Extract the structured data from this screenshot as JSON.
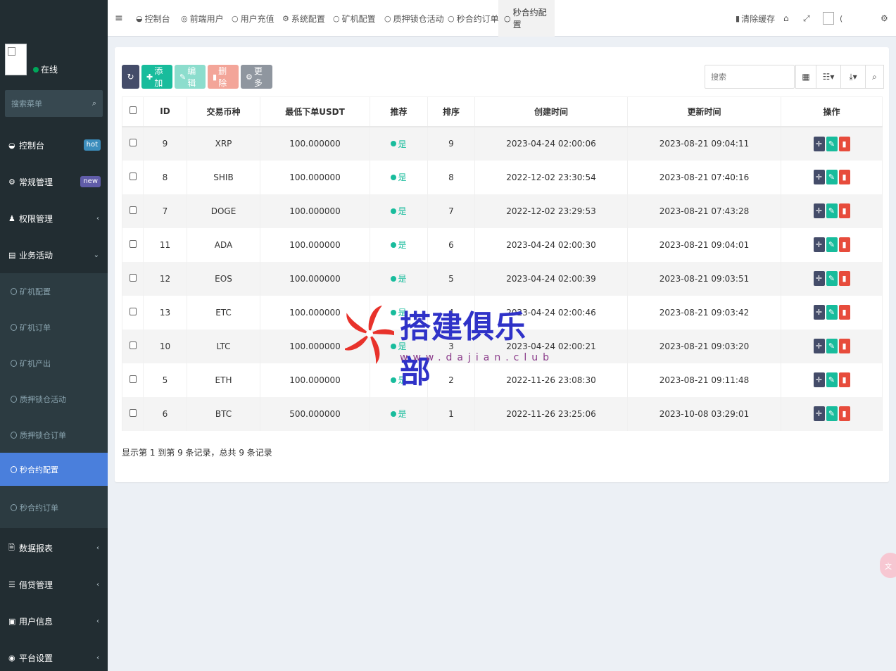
{
  "sidebar": {
    "status": "在线",
    "search_placeholder": "搜索菜单",
    "menu": [
      {
        "label": "控制台",
        "icon": "dashboard-icon",
        "badge": "hot"
      },
      {
        "label": "常规管理",
        "icon": "cogs-icon",
        "badge": "new"
      },
      {
        "label": "权限管理",
        "icon": "group-icon"
      },
      {
        "label": "业务活动",
        "icon": "list-alt-icon"
      },
      {
        "label": "数据报表",
        "icon": "file-icon"
      },
      {
        "label": "借贷管理",
        "icon": "list-icon"
      },
      {
        "label": "用户信息",
        "icon": "user-icon"
      },
      {
        "label": "平台设置",
        "icon": "gear-icon"
      }
    ],
    "submenu": [
      {
        "label": "矿机配置"
      },
      {
        "label": "矿机订单"
      },
      {
        "label": "矿机产出"
      },
      {
        "label": "质押锁仓活动"
      },
      {
        "label": "质押锁仓订单"
      },
      {
        "label": "秒合约配置",
        "active": true
      },
      {
        "label": "秒合约订单"
      }
    ]
  },
  "topbar": {
    "tabs": [
      {
        "label": "控制台",
        "icon": "dashboard-icon"
      },
      {
        "label": "前端用户",
        "icon": "user-circle-icon"
      },
      {
        "label": "用户充值",
        "icon": "circle-icon"
      },
      {
        "label": "系统配置",
        "icon": "gear-icon"
      },
      {
        "label": "矿机配置",
        "icon": "circle-icon"
      },
      {
        "label": "质押锁仓活动",
        "icon": "circle-icon"
      },
      {
        "label": "秒合约订单",
        "icon": "circle-icon"
      },
      {
        "label": "秒合约配置",
        "icon": "circle-icon",
        "active": true
      }
    ],
    "clear_cache": "清除缓存",
    "user_name": "("
  },
  "toolbar": {
    "add": "添加",
    "edit": "编辑",
    "delete": "删除",
    "more": "更多",
    "search_placeholder": "搜索"
  },
  "table": {
    "headers": [
      "ID",
      "交易币种",
      "最低下单USDT",
      "推荐",
      "排序",
      "创建时间",
      "更新时间",
      "操作"
    ],
    "rows": [
      {
        "id": "9",
        "coin": "XRP",
        "min": "100.000000",
        "rec": "是",
        "sort": "9",
        "created": "2023-04-24 02:00:06",
        "updated": "2023-08-21 09:04:11"
      },
      {
        "id": "8",
        "coin": "SHIB",
        "min": "100.000000",
        "rec": "是",
        "sort": "8",
        "created": "2022-12-02 23:30:54",
        "updated": "2023-08-21 07:40:16"
      },
      {
        "id": "7",
        "coin": "DOGE",
        "min": "100.000000",
        "rec": "是",
        "sort": "7",
        "created": "2022-12-02 23:29:53",
        "updated": "2023-08-21 07:43:28"
      },
      {
        "id": "11",
        "coin": "ADA",
        "min": "100.000000",
        "rec": "是",
        "sort": "6",
        "created": "2023-04-24 02:00:30",
        "updated": "2023-08-21 09:04:01"
      },
      {
        "id": "12",
        "coin": "EOS",
        "min": "100.000000",
        "rec": "是",
        "sort": "5",
        "created": "2023-04-24 02:00:39",
        "updated": "2023-08-21 09:03:51"
      },
      {
        "id": "13",
        "coin": "ETC",
        "min": "100.000000",
        "rec": "是",
        "sort": "4",
        "created": "2023-04-24 02:00:46",
        "updated": "2023-08-21 09:03:42"
      },
      {
        "id": "10",
        "coin": "LTC",
        "min": "100.000000",
        "rec": "是",
        "sort": "3",
        "created": "2023-04-24 02:00:21",
        "updated": "2023-08-21 09:03:20"
      },
      {
        "id": "5",
        "coin": "ETH",
        "min": "100.000000",
        "rec": "是",
        "sort": "2",
        "created": "2022-11-26 23:08:30",
        "updated": "2023-08-21 09:11:48"
      },
      {
        "id": "6",
        "coin": "BTC",
        "min": "500.000000",
        "rec": "是",
        "sort": "1",
        "created": "2022-11-26 23:25:06",
        "updated": "2023-10-08 03:29:01"
      }
    ],
    "footer": "显示第 1 到第 9 条记录，总共 9 条记录"
  },
  "watermark": {
    "text": "搭建俱乐部",
    "url": "www.dajian.club"
  },
  "colors": {
    "sidebar_bg": "#222d32",
    "active": "#4a7fdc",
    "success": "#18bc9c",
    "danger": "#e74c3c"
  }
}
